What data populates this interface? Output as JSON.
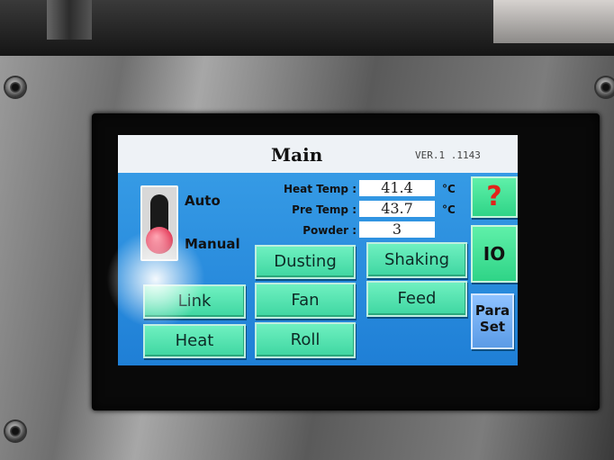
{
  "screen": {
    "title": "Main",
    "version": "VER.1 .1143"
  },
  "mode_switch": {
    "auto_label": "Auto",
    "manual_label": "Manual",
    "selected": "Manual"
  },
  "params": {
    "heat_temp": {
      "label": "Heat Temp :",
      "value": "41.4",
      "unit": "°C"
    },
    "pre_temp": {
      "label": "Pre Temp :",
      "value": "43.7",
      "unit": "°C"
    },
    "powder": {
      "label": "Powder :",
      "value": "3"
    }
  },
  "buttons": {
    "dusting": "Dusting",
    "shaking": "Shaking",
    "link": "Link",
    "fan": "Fan",
    "feed": "Feed",
    "heat": "Heat",
    "roll": "Roll"
  },
  "side_buttons": {
    "help": "?",
    "io": "IO",
    "para_line1": "Para",
    "para_line2": "Set"
  },
  "colors": {
    "screen_bg": "#2a8fe0",
    "button_green": "#4fe2ae",
    "help_red": "#e2231a",
    "knob_pink": "#e33a58"
  }
}
